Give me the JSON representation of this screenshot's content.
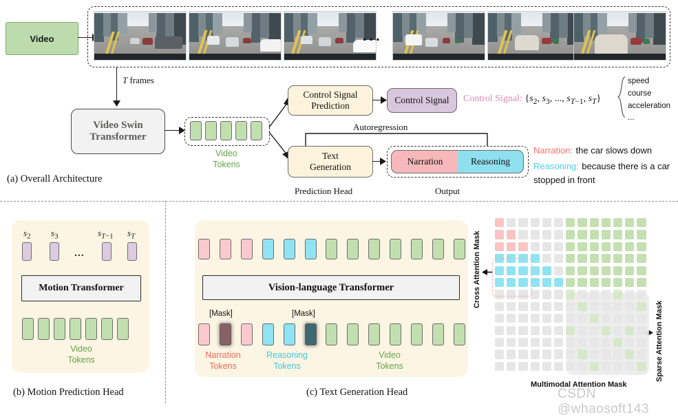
{
  "figure": {
    "watermark": "CSDN @whaosoft143"
  },
  "panel_a": {
    "caption": "(a) Overall Architecture",
    "video_box_label": "Video",
    "frames_label_italic": "T",
    "frames_label_rest": " frames",
    "backbone_line1": "Video Swin",
    "backbone_line2": "Transformer",
    "video_tokens_label_line1": "Video",
    "video_tokens_label_line2": "Tokens",
    "control_pred_line1": "Control Signal",
    "control_pred_line2": "Prediction",
    "control_signal_box": "Control Signal",
    "text_gen_line1": "Text",
    "text_gen_line2": "Generation",
    "autoregression_label": "Autoregression",
    "narration_box": "Narration",
    "reasoning_box": "Reasoning",
    "prediction_head_label": "Prediction Head",
    "output_label": "Output",
    "control_signal_annotation_prefix": "Control Signal:",
    "control_signal_set": "{s2, s3, ..., sT−1, sT}",
    "control_signal_items": [
      "speed",
      "course",
      "acceleration",
      "..."
    ],
    "narration_key": "Narration:",
    "narration_value": "the car slows down",
    "reasoning_key": "Reasoning:",
    "reasoning_value_line1": "because there is a car",
    "reasoning_value_line2": "stopped in front",
    "frame_dots": "..."
  },
  "panel_b": {
    "caption": "(b) Motion Prediction Head",
    "transformer_label": "Motion Transformer",
    "signal_labels": [
      "s2",
      "s3",
      "...",
      "sT−1",
      "sT"
    ],
    "signal_token_count": 4,
    "video_token_count": 7,
    "video_tokens_label_line1": "Video",
    "video_tokens_label_line2": "Tokens"
  },
  "panel_c": {
    "caption": "(c) Text Generation Head",
    "transformer_label": "Vision-language Transformer",
    "mask_label": "[Mask]",
    "narration_tokens_line1": "Narration",
    "narration_tokens_line2": "Tokens",
    "reasoning_tokens_line1": "Reasoning",
    "reasoning_tokens_line2": "Tokens",
    "video_tokens_line1": "Video",
    "video_tokens_line2": "Tokens",
    "top_row_tokens": [
      "pink",
      "pink",
      "pink",
      "cyan",
      "cyan",
      "cyan",
      "green",
      "green",
      "green",
      "green",
      "green",
      "green",
      "green"
    ],
    "bottom_row_tokens": [
      "pink",
      "maskp",
      "pink",
      "cyan",
      "cyan",
      "maskc",
      "green",
      "green",
      "green",
      "green",
      "green",
      "green",
      "green"
    ],
    "mask_positions": [
      1,
      5
    ]
  },
  "panel_d": {
    "bottom_caption": "Multimodal Attention Mask",
    "left_label": "Cross Attention Mask",
    "right_label": "Sparse Attention Mask",
    "grid_rows": 13,
    "grid_cols": 13,
    "grid": [
      [
        "pink",
        "grey",
        "grey",
        "grey",
        "grey",
        "grey",
        "green",
        "green",
        "green",
        "green",
        "green",
        "green",
        "green"
      ],
      [
        "pink",
        "pink",
        "grey",
        "grey",
        "grey",
        "grey",
        "green",
        "green",
        "green",
        "green",
        "green",
        "green",
        "green"
      ],
      [
        "pink",
        "pink",
        "pink",
        "grey",
        "grey",
        "grey",
        "green",
        "green",
        "green",
        "green",
        "green",
        "green",
        "green"
      ],
      [
        "cyan",
        "cyan",
        "cyan",
        "cyan",
        "grey",
        "grey",
        "green",
        "green",
        "green",
        "green",
        "green",
        "green",
        "green"
      ],
      [
        "cyan",
        "cyan",
        "cyan",
        "cyan",
        "cyan",
        "grey",
        "green",
        "green",
        "green",
        "green",
        "green",
        "green",
        "green"
      ],
      [
        "cyan",
        "cyan",
        "cyan",
        "cyan",
        "cyan",
        "cyan",
        "green",
        "green",
        "green",
        "green",
        "green",
        "green",
        "green"
      ],
      [
        "grey",
        "grey",
        "grey",
        "grey",
        "grey",
        "grey",
        "sgreen",
        "sgrey",
        "sgrey",
        "sgrey",
        "sgreen",
        "sgrey",
        "sgrey"
      ],
      [
        "grey",
        "grey",
        "grey",
        "grey",
        "grey",
        "grey",
        "sgrey",
        "sgreen",
        "sgrey",
        "sgrey",
        "sgrey",
        "sgrey",
        "sgreen"
      ],
      [
        "grey",
        "grey",
        "grey",
        "grey",
        "grey",
        "grey",
        "sgrey",
        "sgrey",
        "sgreen",
        "sgrey",
        "sgrey",
        "sgrey",
        "sgrey"
      ],
      [
        "grey",
        "grey",
        "grey",
        "grey",
        "grey",
        "grey",
        "sgreen",
        "sgrey",
        "sgrey",
        "sgreen",
        "sgrey",
        "sgreen",
        "sgrey"
      ],
      [
        "grey",
        "grey",
        "grey",
        "grey",
        "grey",
        "grey",
        "sgrey",
        "sgrey",
        "sgrey",
        "sgrey",
        "sgreen",
        "sgrey",
        "sgrey"
      ],
      [
        "grey",
        "grey",
        "grey",
        "grey",
        "grey",
        "grey",
        "sgrey",
        "sgreen",
        "sgrey",
        "sgrey",
        "sgrey",
        "sgreen",
        "sgrey"
      ],
      [
        "grey",
        "grey",
        "grey",
        "grey",
        "grey",
        "grey",
        "sgrey",
        "sgrey",
        "sgreen",
        "sgrey",
        "sgrey",
        "sgrey",
        "sgreen"
      ]
    ],
    "cross_attention_highlight": {
      "row_start": 3,
      "row_end": 5,
      "col_start": 0,
      "col_end": 2
    }
  },
  "colors": {
    "video_green": "#bcdcae",
    "token_green": "#c2dfb0",
    "token_pink": "#f9c9cf",
    "token_cyan": "#8fe3f3",
    "token_purple": "#ddcbe0",
    "cream_panel": "#fdf5e3",
    "cream_box": "#fdf3dc",
    "purple_box": "#d9c7dd",
    "narration_pink": "#f6b8bb",
    "reasoning_cyan": "#8fe0ef",
    "label_green": "#63a34a",
    "label_pink": "#f06a5a",
    "label_cyan": "#3ec8e0",
    "control_signal_text": "#d98ab0",
    "grid_grey": "#e6e6e6"
  }
}
